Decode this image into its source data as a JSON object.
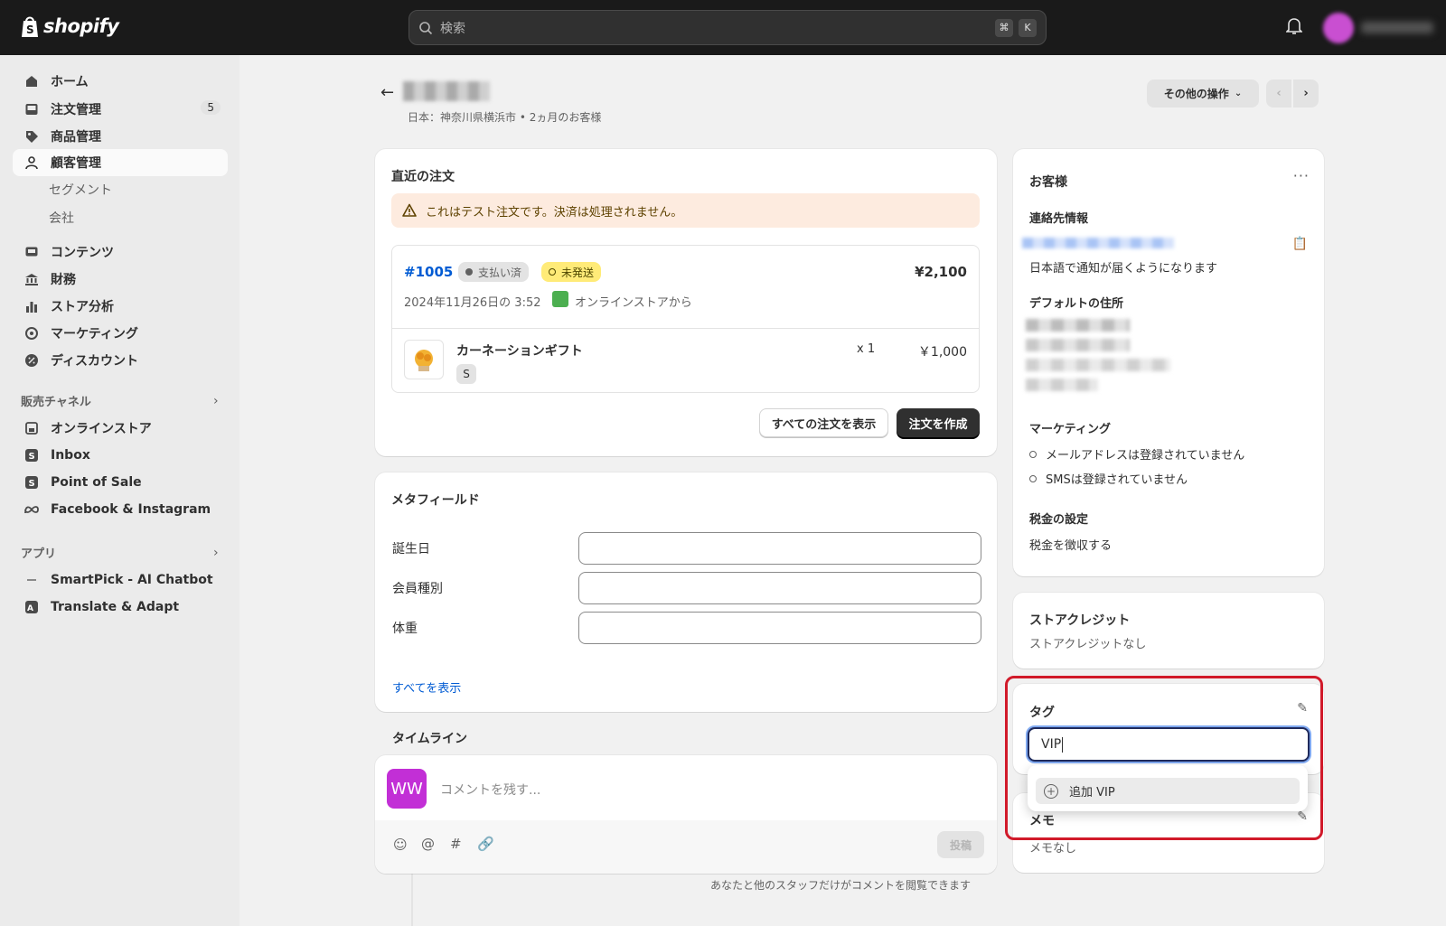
{
  "topbar": {
    "logo_text": "shopify",
    "search_placeholder": "検索",
    "shortcut_cmd": "⌘",
    "shortcut_key": "K"
  },
  "sidebar": {
    "items": [
      {
        "label": "ホーム",
        "icon": "home-icon"
      },
      {
        "label": "注文管理",
        "icon": "inbox-icon",
        "badge": "5"
      },
      {
        "label": "商品管理",
        "icon": "tag-icon"
      },
      {
        "label": "顧客管理",
        "icon": "person-icon"
      },
      {
        "label": "コンテンツ",
        "icon": "content-icon"
      },
      {
        "label": "財務",
        "icon": "bank-icon"
      },
      {
        "label": "ストア分析",
        "icon": "bar-chart-icon"
      },
      {
        "label": "マーケティング",
        "icon": "target-icon"
      },
      {
        "label": "ディスカウント",
        "icon": "discount-icon"
      }
    ],
    "customer_sub": [
      "セグメント",
      "会社"
    ],
    "sales_channels_label": "販売チャネル",
    "channels": [
      "オンラインストア",
      "Inbox",
      "Point of Sale",
      "Facebook & Instagram"
    ],
    "apps_label": "アプリ",
    "apps": [
      "SmartPick - AI Chatbot",
      "Translate & Adapt"
    ]
  },
  "header": {
    "subtitle": "日本：神奈川県横浜市 • 2ヵ月のお客様",
    "more_actions": "その他の操作"
  },
  "recent_orders": {
    "title": "直近の注文",
    "test_banner": "これはテスト注文です。決済は処理されません。",
    "order": {
      "number": "#1005",
      "payment_status": "支払い済",
      "fulfillment_status": "未発送",
      "total": "¥2,100",
      "date": "2024年11月26日の 3:52",
      "source": "オンラインストアから",
      "item_name": "カーネーションギフト",
      "variant": "S",
      "quantity": "x 1",
      "item_price": "￥1,000"
    },
    "view_all": "すべての注文を表示",
    "create_order": "注文を作成"
  },
  "metafields": {
    "title": "メタフィールド",
    "fields": [
      "誕生日",
      "会員種別",
      "体重"
    ],
    "view_all": "すべてを表示"
  },
  "timeline": {
    "title": "タイムライン",
    "avatar_initials": "WW",
    "comment_placeholder": "コメントを残す...",
    "post_button": "投稿",
    "note": "あなたと他のスタッフだけがコメントを閲覧できます"
  },
  "customer": {
    "title": "お客様",
    "contact_title": "連絡先情報",
    "notification_lang": "日本語で通知が届くようになります",
    "address_title": "デフォルトの住所",
    "marketing_title": "マーケティング",
    "marketing_email": "メールアドレスは登録されていません",
    "marketing_sms": "SMSは登録されていません",
    "tax_title": "税金の設定",
    "tax_value": "税金を徴収する"
  },
  "store_credit": {
    "title": "ストアクレジット",
    "value": "ストアクレジットなし"
  },
  "tags": {
    "title": "タグ",
    "input_value": "VIP",
    "suggestion": "追加 VIP"
  },
  "notes": {
    "title": "メモ",
    "value": "メモなし"
  },
  "colors": {
    "highlight": "#d11a2a",
    "link": "#005bd3",
    "accent_avatar": "#c22fd6"
  }
}
